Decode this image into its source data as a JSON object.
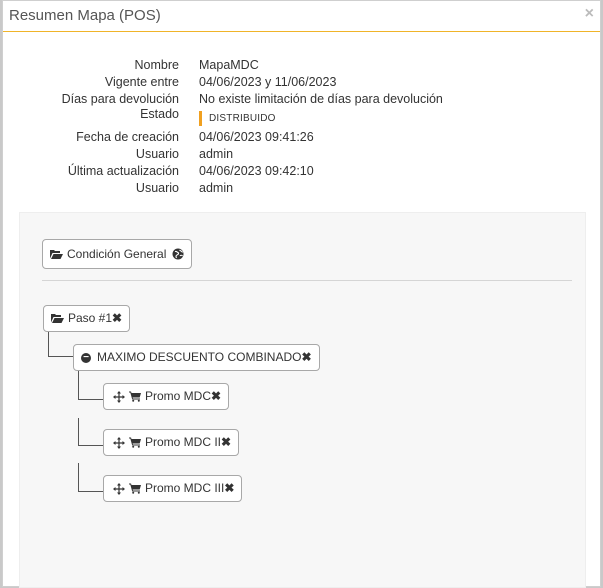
{
  "modal": {
    "title": "Resumen Mapa (POS)",
    "close": "×"
  },
  "info": {
    "nombre": {
      "label": "Nombre",
      "value": "MapaMDC"
    },
    "vigente": {
      "label": "Vigente entre",
      "value": "04/06/2023 y 11/06/2023"
    },
    "dias": {
      "label": "Días para devolución",
      "value": "No existe limitación de días para devolución"
    },
    "estado": {
      "label": "Estado",
      "value": "DISTRIBUIDO"
    },
    "creacion": {
      "label": "Fecha de creación",
      "value": "04/06/2023 09:41:26"
    },
    "usuario1": {
      "label": "Usuario",
      "value": "admin"
    },
    "actualizacion": {
      "label": "Última actualización",
      "value": "04/06/2023 09:42:10"
    },
    "usuario2": {
      "label": "Usuario",
      "value": "admin"
    }
  },
  "tree": {
    "general": "Condición General",
    "paso": "Paso #1",
    "grupo": "MAXIMO DESCUENTO COMBINADO",
    "promos": [
      "Promo MDC",
      "Promo MDC II",
      "Promo MDC III"
    ]
  },
  "icons": {
    "folder": "folder-open-icon",
    "globe": "globe-icon",
    "remove": "remove-icon",
    "minus": "minus-circle-icon",
    "move": "move-arrows-icon",
    "cart": "cart-icon"
  },
  "colors": {
    "accent": "#f0b429",
    "status_bar": "#f0a020"
  }
}
